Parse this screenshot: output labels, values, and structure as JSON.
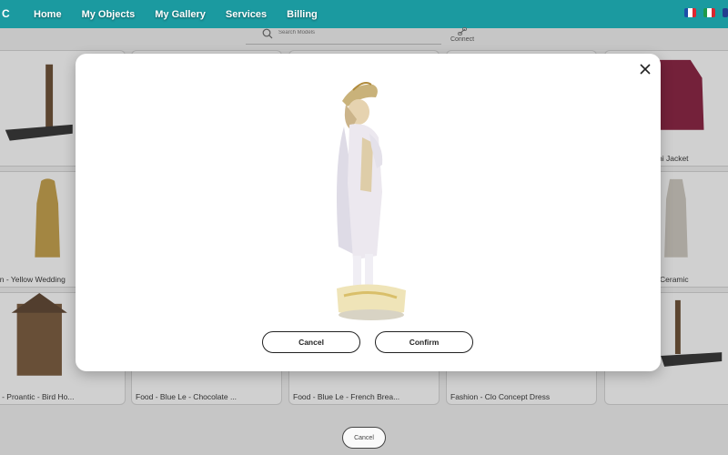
{
  "nav": {
    "logo": "C",
    "items": [
      "Home",
      "My Objects",
      "My Gallery",
      "Services",
      "Billing"
    ]
  },
  "search": {
    "placeholder": "Search Models",
    "connect_label": "Connect"
  },
  "cards": [
    "on - Yellow Wedding",
    "ni Jacket",
    "Ceramic",
    "e - Proantic - Bird Ho...",
    "Food - Blue Le - Chocolate ...",
    "Food - Blue Le - French Brea...",
    "Fashion - Clo Concept Dress"
  ],
  "modal": {
    "cancel_label": "Cancel",
    "confirm_label": "Confirm"
  },
  "bottom": {
    "cancel_label": "Cancel"
  },
  "colors": {
    "nav": "#1b9aa0",
    "overlay": "rgba(40,40,40,0.22)"
  }
}
